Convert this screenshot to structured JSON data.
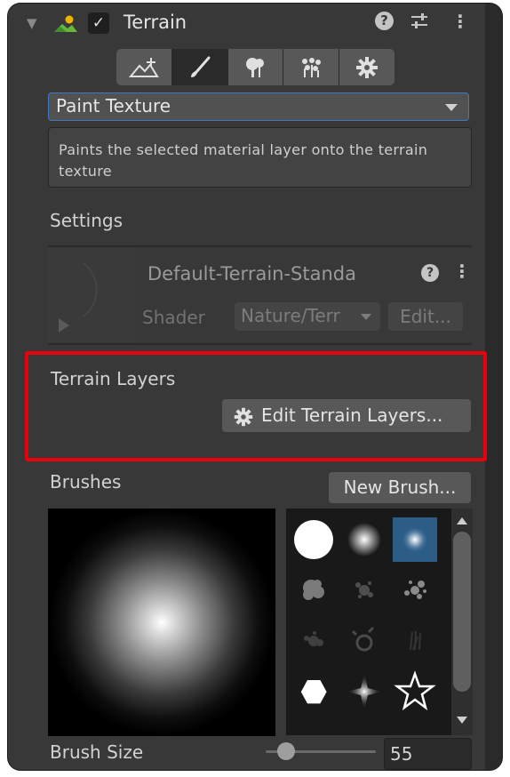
{
  "component": {
    "title": "Terrain",
    "enabled_check": "✓",
    "help_icon": "question-icon",
    "preset_icon": "preset-sliders-icon",
    "menu_icon": "kebab-menu-icon"
  },
  "toolbar": {
    "tools": [
      {
        "name": "raise-terrain-icon",
        "active": false
      },
      {
        "name": "paint-brush-icon",
        "active": true
      },
      {
        "name": "tree-icon",
        "active": false
      },
      {
        "name": "detail-flowers-icon",
        "active": false
      },
      {
        "name": "settings-gear-icon",
        "active": false
      }
    ]
  },
  "mode_dropdown": {
    "selected": "Paint Texture"
  },
  "description": "Paints the selected material layer onto the terrain texture",
  "settings": {
    "title": "Settings",
    "material_name": "Default-Terrain-Standa",
    "shader_label": "Shader",
    "shader_value": "Nature/Terr",
    "edit_label": "Edit..."
  },
  "terrain_layers": {
    "title": "Terrain Layers",
    "edit_button": "Edit Terrain Layers..."
  },
  "brushes": {
    "title": "Brushes",
    "new_button": "New Brush...",
    "selected_index": 2,
    "items": [
      "circle-solid",
      "circle-soft",
      "circle-soft-small",
      "noise-cloud",
      "splatter-1",
      "splatter-2",
      "splatter-3",
      "splatter-4",
      "splatter-5",
      "hexagon",
      "star-burst",
      "star-outline"
    ],
    "size_label": "Brush Size",
    "size_value": "55",
    "size_slider_fraction": 0.22
  },
  "colors": {
    "panel": "#383838",
    "highlight_border": "#e8000b",
    "selected_brush": "#2c5d87",
    "dropdown_focus": "#3c78c3"
  }
}
